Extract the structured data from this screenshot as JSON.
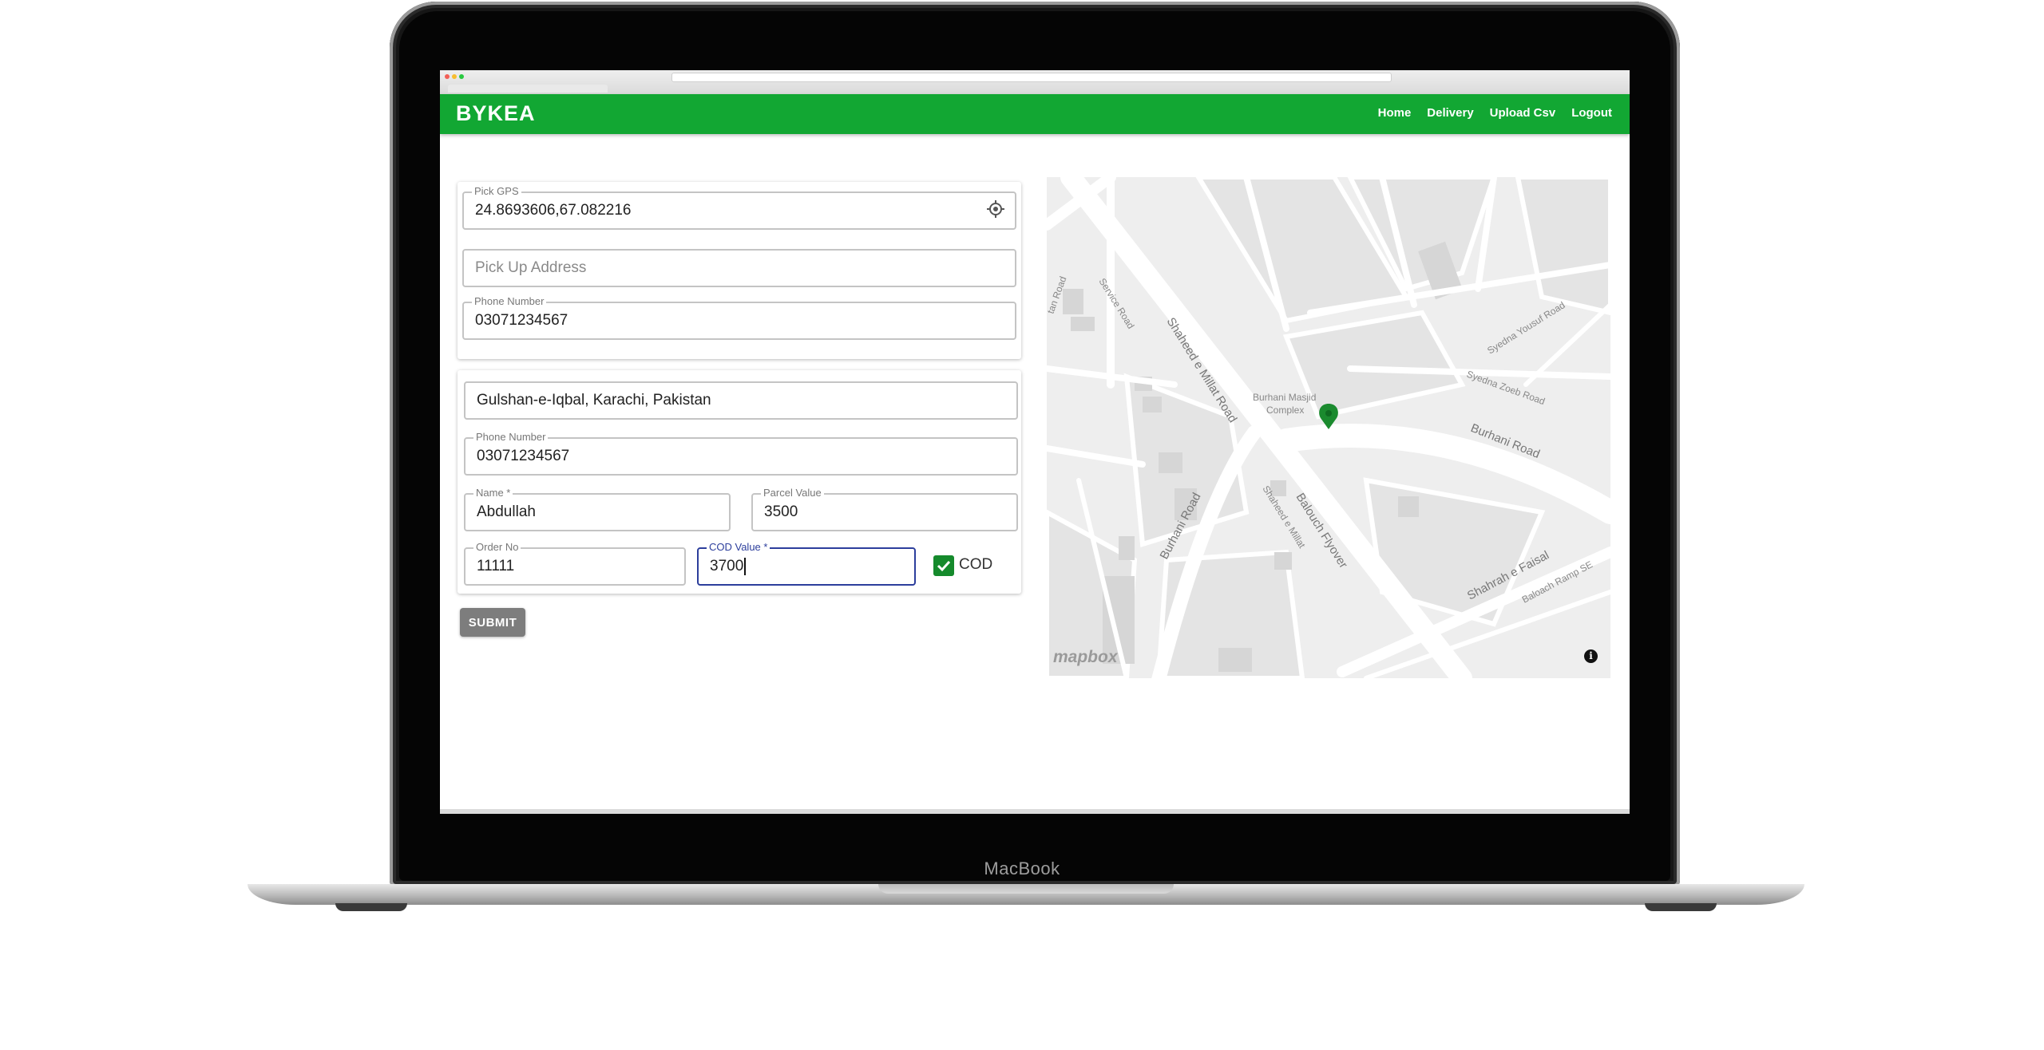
{
  "device": {
    "brand": "MacBook"
  },
  "navbar": {
    "logo": "BYKEA",
    "links": [
      "Home",
      "Delivery",
      "Upload Csv",
      "Logout"
    ],
    "color": "#12a733"
  },
  "pickup": {
    "gps_label": "Pick GPS",
    "gps_value": "24.8693606,67.082216",
    "address_placeholder": "Pick Up Address",
    "phone_label": "Phone Number",
    "phone_value": "03071234567"
  },
  "dropoff": {
    "address_value": "Gulshan-e-Iqbal, Karachi, Pakistan",
    "phone_label": "Phone Number",
    "phone_value": "03071234567",
    "name_label": "Name *",
    "name_value": "Abdullah",
    "parcel_label": "Parcel Value",
    "parcel_value": "3500",
    "order_label": "Order No",
    "order_value": "11111",
    "cod_value_label": "COD Value *",
    "cod_value": "3700",
    "cod_checkbox_label": "COD",
    "cod_checked": true
  },
  "submit_label": "SUBMIT",
  "map": {
    "attribution": "mapbox",
    "info": "i",
    "marker_color": "#1a8a2e",
    "labels": {
      "shaheed_millat": "Shaheed e Millat Road",
      "service_road": "Service Road",
      "tan_road": "tan Road",
      "burhani_masjid": "Burhani Masjid",
      "complex": "Complex",
      "burhani_road_1": "Burhani Road",
      "burhani_road_2": "Burhani Road",
      "syedna_yousuf": "Syedna Yousuf Road",
      "syedna_zoeb": "Syedna Zoeb Road",
      "shaheed_millat_small": "Shaheed e Millat",
      "balouch_flyover": "Balouch Flyover",
      "shahrah_faisal": "Shahrah e Faisal",
      "baloach_ramp": "Baloach Ramp SE"
    }
  }
}
